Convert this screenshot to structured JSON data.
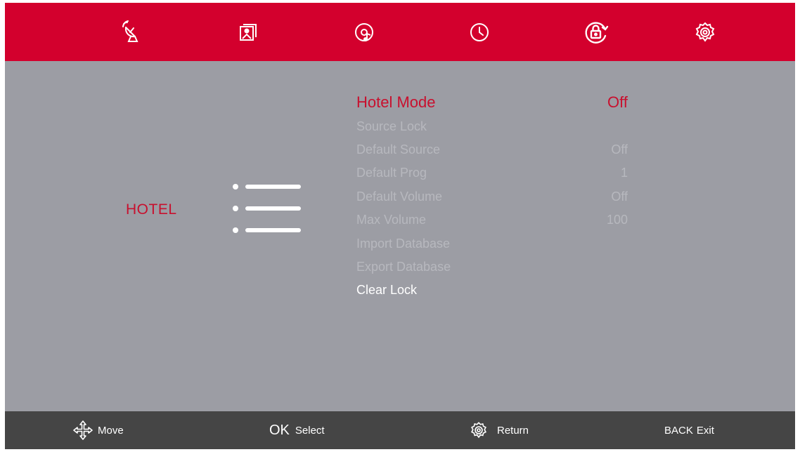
{
  "top_tabs": [
    {
      "icon": "satellite-dish-icon"
    },
    {
      "icon": "picture-icon"
    },
    {
      "icon": "sound-icon"
    },
    {
      "icon": "clock-icon"
    },
    {
      "icon": "lock-icon",
      "active": true
    },
    {
      "icon": "gear-icon"
    }
  ],
  "category": {
    "label": "HOTEL",
    "icon": "list-icon"
  },
  "menu": {
    "items": [
      {
        "label": "Hotel Mode",
        "value": "Off",
        "state": "selected"
      },
      {
        "label": "Source Lock",
        "value": ""
      },
      {
        "label": "Default Source",
        "value": "Off"
      },
      {
        "label": "Default Prog",
        "value": "1"
      },
      {
        "label": "Default Volume",
        "value": "Off"
      },
      {
        "label": "Max Volume",
        "value": "100"
      },
      {
        "label": "Import Database",
        "value": ""
      },
      {
        "label": "Export Database",
        "value": ""
      },
      {
        "label": "Clear Lock",
        "value": "",
        "state": "current"
      }
    ]
  },
  "footer": {
    "move": {
      "label": "Move",
      "icon": "move-arrows-icon"
    },
    "select": {
      "key": "OK",
      "label": "Select"
    },
    "return": {
      "label": "Return",
      "icon": "gear-icon"
    },
    "exit": {
      "key": "BACK",
      "label": "Exit"
    }
  },
  "colors": {
    "accent": "#d3002d",
    "background": "#9c9da4",
    "footer": "#454545"
  }
}
